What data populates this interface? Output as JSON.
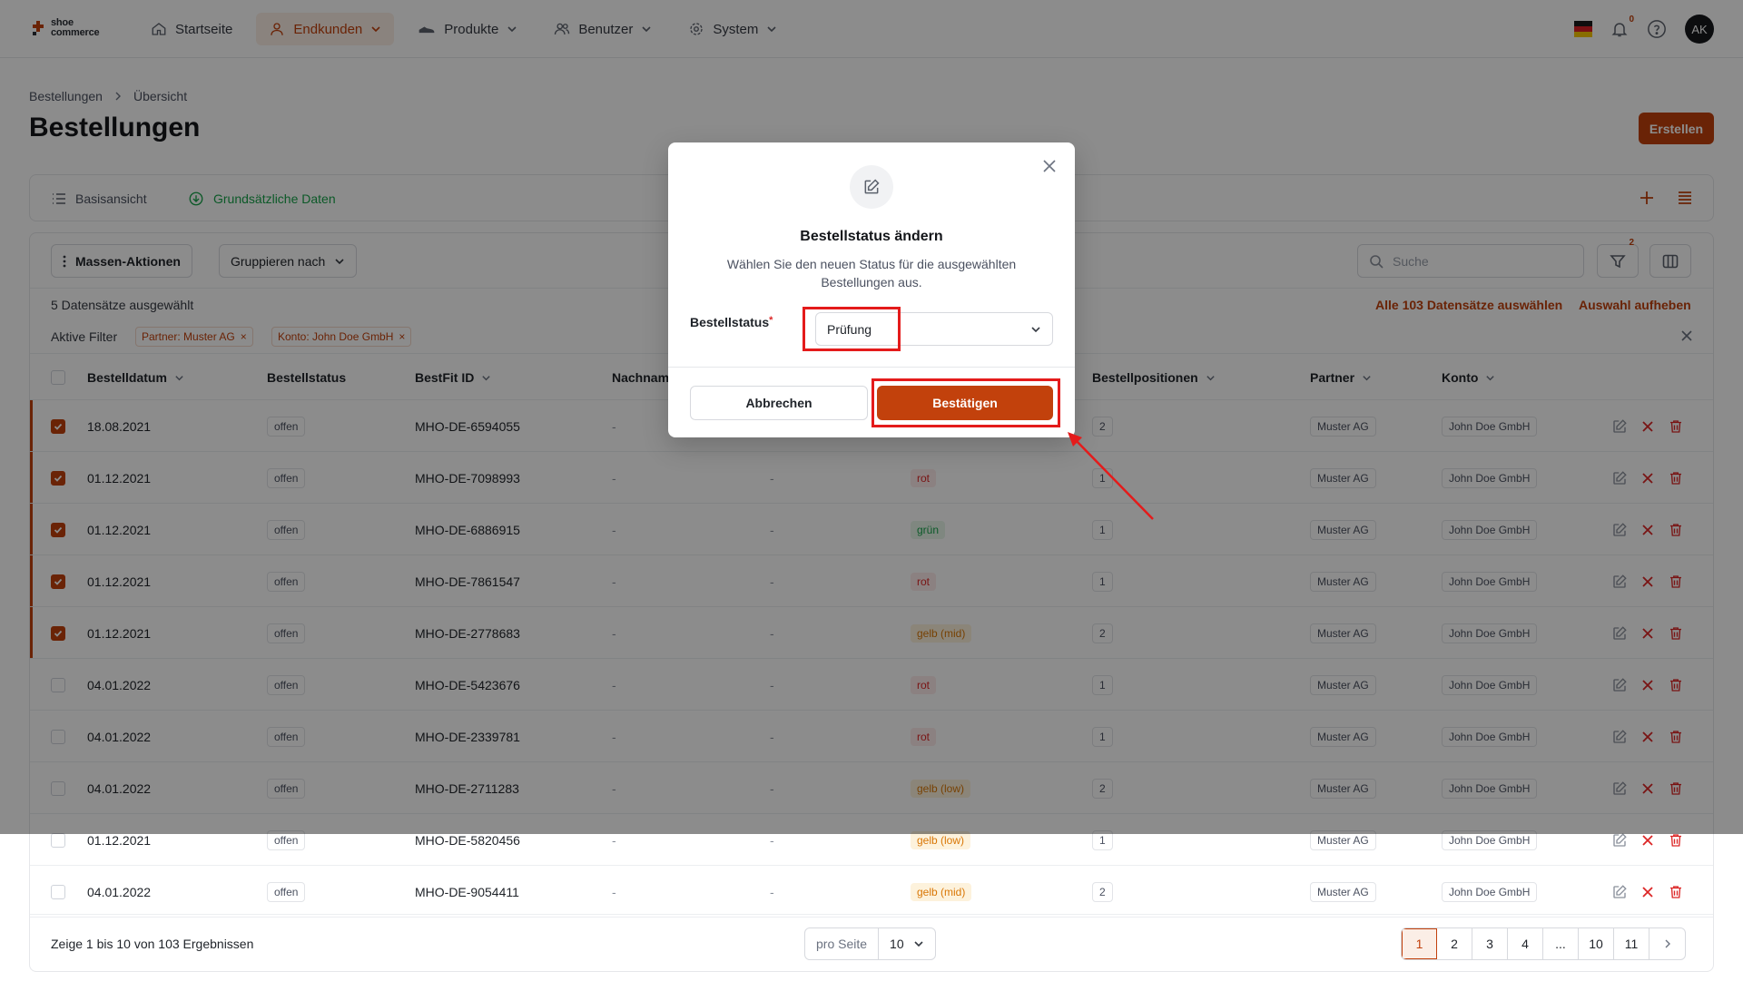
{
  "brand": {
    "line1": "shoe",
    "line2": "commerce"
  },
  "nav": {
    "items": [
      {
        "label": "Startseite",
        "icon": "home-icon",
        "active": false,
        "dropdown": false
      },
      {
        "label": "Endkunden",
        "icon": "user-icon",
        "active": true,
        "dropdown": true
      },
      {
        "label": "Produkte",
        "icon": "shoe-icon",
        "active": false,
        "dropdown": true
      },
      {
        "label": "Benutzer",
        "icon": "users-icon",
        "active": false,
        "dropdown": true
      },
      {
        "label": "System",
        "icon": "gear-icon",
        "active": false,
        "dropdown": true
      }
    ],
    "notification_count": "0",
    "avatar_initials": "AK",
    "language_flag": "de"
  },
  "breadcrumb": {
    "parent": "Bestellungen",
    "current": "Übersicht"
  },
  "page": {
    "title": "Bestellungen",
    "create_label": "Erstellen"
  },
  "views": {
    "basic": "Basisansicht",
    "data": "Grundsätzliche Daten"
  },
  "toolbar": {
    "mass_actions": "Massen-Aktionen",
    "group_by": "Gruppieren nach",
    "search_placeholder": "Suche",
    "filter_count": "2"
  },
  "selection": {
    "count_text": "5 Datensätze ausgewählt",
    "select_all": "Alle 103 Datensätze auswählen",
    "clear": "Auswahl aufheben"
  },
  "filters": {
    "label": "Aktive Filter",
    "chips": [
      "Partner: Muster AG",
      "Konto: John Doe GmbH"
    ]
  },
  "table": {
    "columns": {
      "date": "Bestelldatum",
      "status": "Bestellstatus",
      "bestfit": "BestFit ID",
      "lastname": "Nachname",
      "positions": "Bestellpositionen",
      "partner": "Partner",
      "account": "Konto"
    },
    "rows": [
      {
        "checked": true,
        "date": "18.08.2021",
        "status": "offen",
        "id": "MHO-DE-6594055",
        "lastname": "-",
        "col5": "-",
        "tag": "",
        "tag_type": "",
        "positions": "2",
        "partner": "Muster AG",
        "account": "John Doe GmbH"
      },
      {
        "checked": true,
        "date": "01.12.2021",
        "status": "offen",
        "id": "MHO-DE-7098993",
        "lastname": "-",
        "col5": "-",
        "tag": "rot",
        "tag_type": "rot",
        "positions": "1",
        "partner": "Muster AG",
        "account": "John Doe GmbH"
      },
      {
        "checked": true,
        "date": "01.12.2021",
        "status": "offen",
        "id": "MHO-DE-6886915",
        "lastname": "-",
        "col5": "-",
        "tag": "grün",
        "tag_type": "gruen",
        "positions": "1",
        "partner": "Muster AG",
        "account": "John Doe GmbH"
      },
      {
        "checked": true,
        "date": "01.12.2021",
        "status": "offen",
        "id": "MHO-DE-7861547",
        "lastname": "-",
        "col5": "-",
        "tag": "rot",
        "tag_type": "rot",
        "positions": "1",
        "partner": "Muster AG",
        "account": "John Doe GmbH"
      },
      {
        "checked": true,
        "date": "01.12.2021",
        "status": "offen",
        "id": "MHO-DE-2778683",
        "lastname": "-",
        "col5": "-",
        "tag": "gelb (mid)",
        "tag_type": "gelb",
        "positions": "2",
        "partner": "Muster AG",
        "account": "John Doe GmbH"
      },
      {
        "checked": false,
        "date": "04.01.2022",
        "status": "offen",
        "id": "MHO-DE-5423676",
        "lastname": "-",
        "col5": "-",
        "tag": "rot",
        "tag_type": "rot",
        "positions": "1",
        "partner": "Muster AG",
        "account": "John Doe GmbH"
      },
      {
        "checked": false,
        "date": "04.01.2022",
        "status": "offen",
        "id": "MHO-DE-2339781",
        "lastname": "-",
        "col5": "-",
        "tag": "rot",
        "tag_type": "rot",
        "positions": "1",
        "partner": "Muster AG",
        "account": "John Doe GmbH"
      },
      {
        "checked": false,
        "date": "04.01.2022",
        "status": "offen",
        "id": "MHO-DE-2711283",
        "lastname": "-",
        "col5": "-",
        "tag": "gelb (low)",
        "tag_type": "gelb",
        "positions": "2",
        "partner": "Muster AG",
        "account": "John Doe GmbH"
      },
      {
        "checked": false,
        "date": "01.12.2021",
        "status": "offen",
        "id": "MHO-DE-5820456",
        "lastname": "-",
        "col5": "-",
        "tag": "gelb (low)",
        "tag_type": "gelb",
        "positions": "1",
        "partner": "Muster AG",
        "account": "John Doe GmbH"
      },
      {
        "checked": false,
        "date": "04.01.2022",
        "status": "offen",
        "id": "MHO-DE-9054411",
        "lastname": "-",
        "col5": "-",
        "tag": "gelb (mid)",
        "tag_type": "gelb",
        "positions": "2",
        "partner": "Muster AG",
        "account": "John Doe GmbH"
      }
    ]
  },
  "footer": {
    "info": "Zeige 1 bis 10 von 103 Ergebnissen",
    "per_page_label": "pro Seite",
    "per_page_value": "10",
    "pages": [
      "1",
      "2",
      "3",
      "4",
      "...",
      "10",
      "11"
    ],
    "current_page": "1"
  },
  "modal": {
    "title": "Bestellstatus ändern",
    "description": "Wählen Sie den neuen Status für die ausgewählten Bestellungen aus.",
    "field_label": "Bestellstatus",
    "required_mark": "*",
    "selected_value": "Prüfung",
    "cancel_label": "Abbrechen",
    "confirm_label": "Bestätigen"
  },
  "colors": {
    "accent": "#c2410c",
    "highlight": "#e41b1b",
    "success": "#17a34a"
  }
}
